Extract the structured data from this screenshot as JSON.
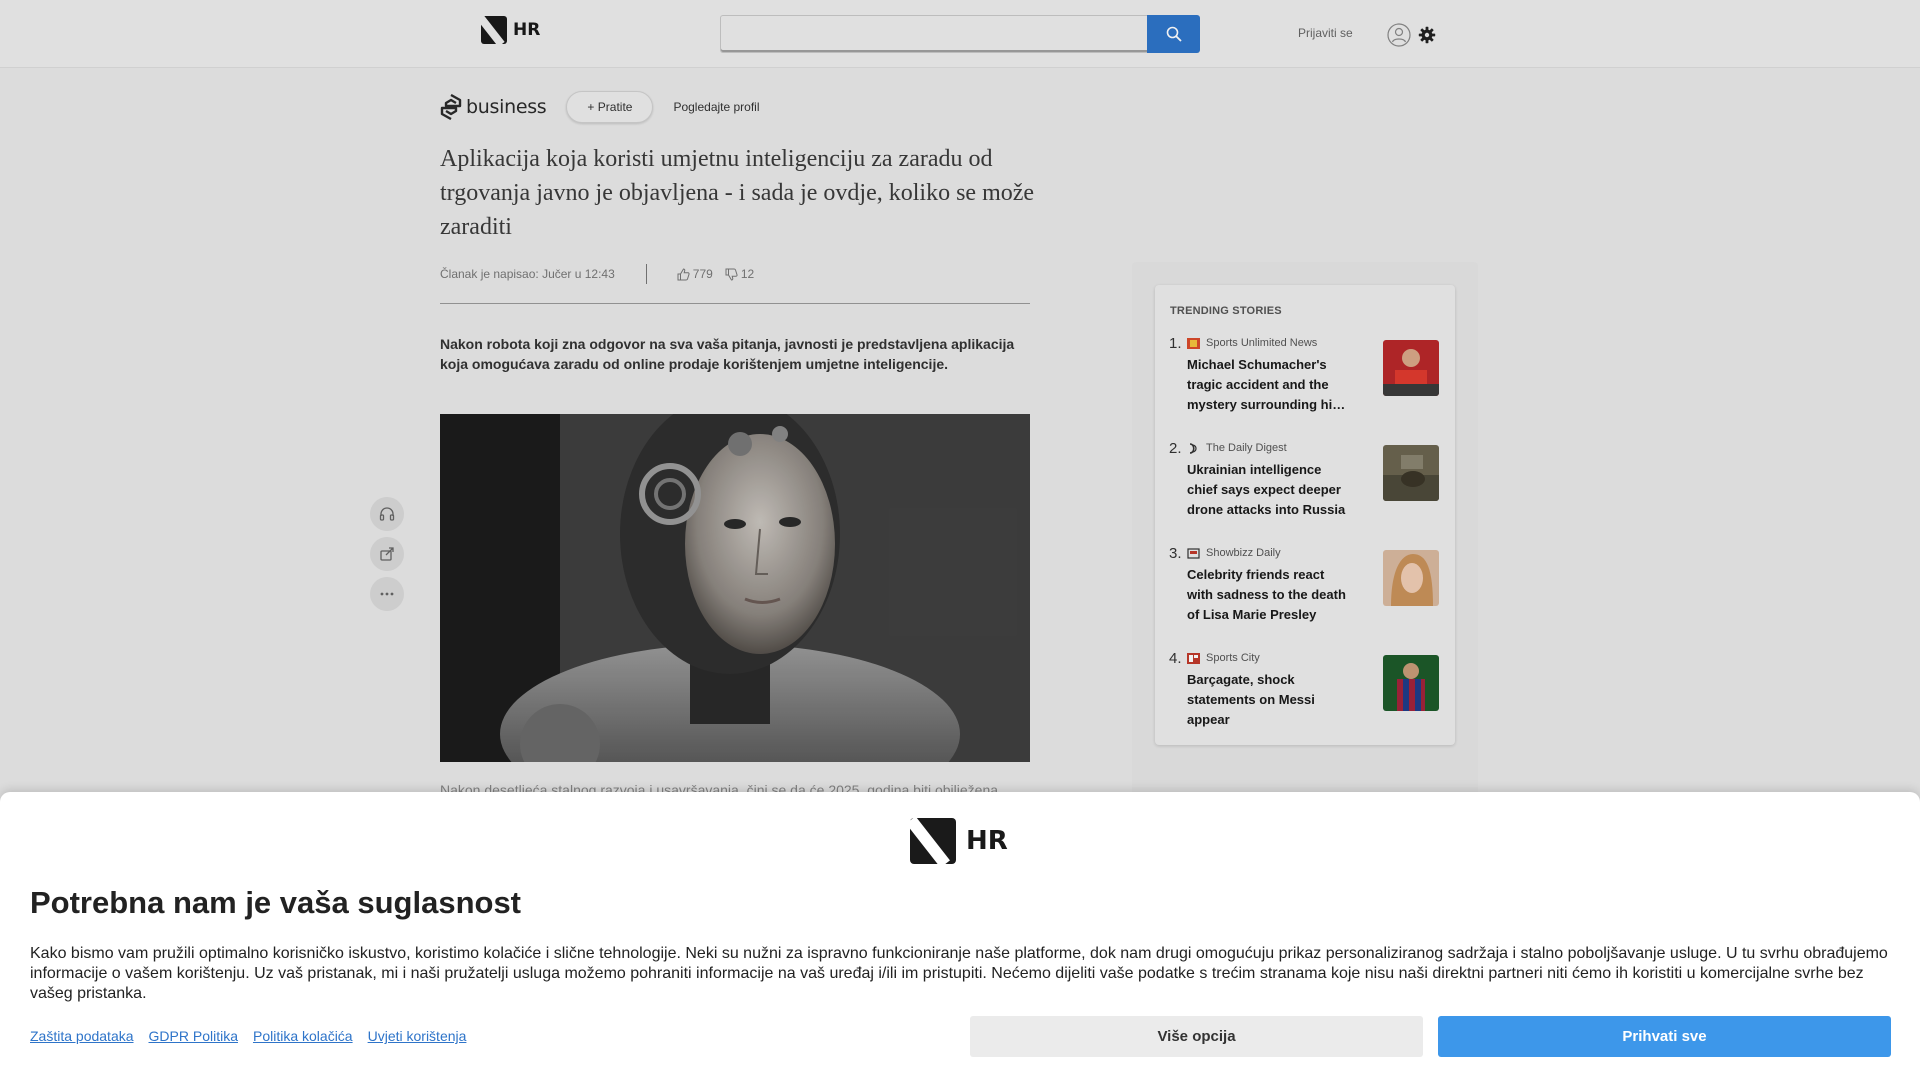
{
  "header": {
    "logo_text": "HR",
    "search_placeholder": "",
    "signin_label": "Prijaviti se",
    "accent_color": "#2e74c9"
  },
  "article": {
    "source_name": "business",
    "follow_label": "+ Pratite",
    "profile_label": "Pogledajte profil",
    "title": "Aplikacija koja koristi umjetnu inteligenciju za zaradu od trgovanja javno je objavljena - i sada je ovdje, koliko se može zaraditi",
    "byline": "Članak je napisao: Jučer u 12:43",
    "likes": "779",
    "dislikes": "12",
    "lead": "Nakon robota koji zna odgovor na sva vaša pitanja, javnosti je predstavljena aplikacija koja omogućava zaradu od online prodaje korištenjem umjetne inteligencije.",
    "body_start": "Nakon desetljeća stalnog razvoja i usavršavanja, čini se da će 2025. godina biti obilježena"
  },
  "trending": {
    "heading": "TRENDING STORIES",
    "items": [
      {
        "num": "1.",
        "source": "Sports Unlimited News",
        "title": "Michael Schumacher's tragic accident and the mystery surrounding his health"
      },
      {
        "num": "2.",
        "source": "The Daily Digest",
        "title": "Ukrainian intelligence chief says expect deeper drone attacks into Russia"
      },
      {
        "num": "3.",
        "source": "Showbizz Daily",
        "title": "Celebrity friends react with sadness to the death of Lisa Marie Presley"
      },
      {
        "num": "4.",
        "source": "Sports City",
        "title": "Barçagate, shock statements on Messi appear"
      }
    ]
  },
  "consent": {
    "logo_text": "HR",
    "title": "Potrebna nam je vaša suglasnost",
    "text": "Kako bismo vam pružili optimalno korisničko iskustvo, koristimo kolačiće i slične tehnologije. Neki su nužni za ispravno funkcioniranje naše platforme, dok nam drugi omogućuju prikaz personaliziranog sadržaja i stalno poboljšavanje usluge. U tu svrhu obrađujemo informacije o vašem korištenju. Uz vaš pristanak, mi i naši pružatelji usluga možemo pohraniti informacije na vaš uređaj i/ili im pristupiti. Nećemo dijeliti vaše podatke s trećim stranama koje nisu naši direktni partneri niti ćemo ih koristiti u komercijalne svrhe bez vašeg pristanka.",
    "links": [
      "Zaštita podataka",
      "GDPR Politika",
      "Politika kolačića",
      "Uvjeti korištenja"
    ],
    "more_label": "Više opcija",
    "accept_label": "Prihvati sve",
    "accept_color": "#3d97ea"
  }
}
